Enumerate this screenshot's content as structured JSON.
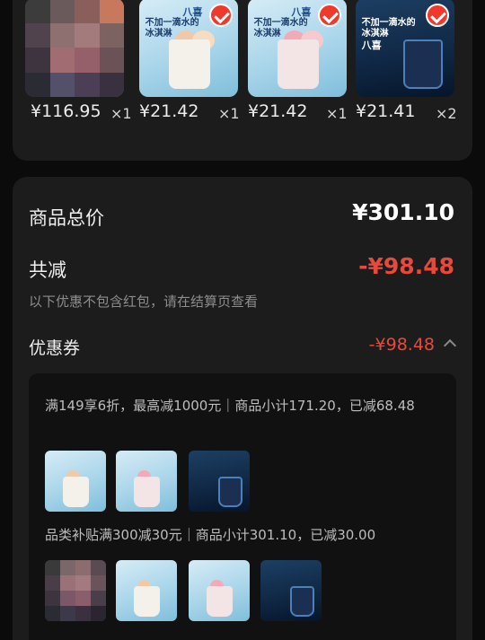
{
  "products": [
    {
      "kind": "blurred",
      "price": "¥116.95",
      "qty": "×1"
    },
    {
      "kind": "light",
      "brand": "八喜",
      "slogan": "不加一滴水的冰淇淋",
      "price": "¥21.42",
      "qty": "×1",
      "selected": true
    },
    {
      "kind": "light-pink",
      "brand": "八喜",
      "slogan": "不加一滴水的冰淇淋",
      "price": "¥21.42",
      "qty": "×1",
      "selected": true
    },
    {
      "kind": "dark",
      "brand": "八喜",
      "slogan": "不加一滴水的冰淇淋",
      "price": "¥21.41",
      "qty": "×2",
      "selected": true
    }
  ],
  "summary": {
    "total_label": "商品总价",
    "total_value": "¥301.10",
    "discount_label": "共减",
    "discount_value": "-¥98.48",
    "note": "以下优惠不包含红包，请在结算页查看",
    "coupon_label": "优惠券",
    "coupon_value": "-¥98.48"
  },
  "coupon_details": [
    {
      "text": "满149享6折，最高减1000元｜商品小计171.20，已减68.48"
    },
    {
      "text": "品类补贴满300减30元｜商品小计301.10，已减30.00"
    }
  ],
  "colors": {
    "accent_red": "#e8493a",
    "card_bg": "#1c1c1c",
    "page_bg": "#0b0b0b"
  }
}
